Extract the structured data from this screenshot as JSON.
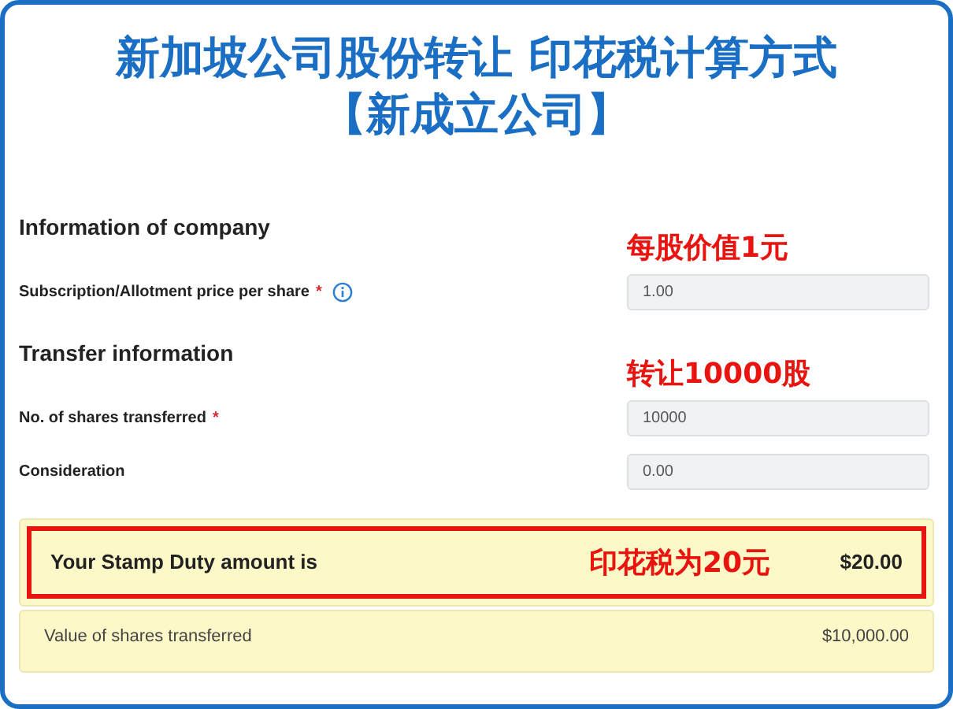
{
  "title_lines": [
    "新加坡公司股份转让 印花税计算方式",
    "【新成立公司】"
  ],
  "sections": [
    {
      "heading": "Information of company",
      "note": "每股价值1元",
      "fields": [
        {
          "label": "Subscription/Allotment price per share",
          "required_mark": "*",
          "info": true,
          "value": "1.00"
        }
      ]
    },
    {
      "heading": "Transfer information",
      "note": "转让10000股",
      "fields": [
        {
          "label": "No. of shares transferred",
          "required_mark": "*",
          "info": false,
          "value": "10000"
        },
        {
          "label": "Consideration",
          "info": false,
          "value": "0.00"
        }
      ]
    }
  ],
  "result": {
    "label": "Your Stamp Duty amount is",
    "note": "印花税为20元",
    "amount": "$20.00",
    "highlighted": true
  },
  "detail": {
    "label": "Value of shares transferred",
    "amount": "$10,000.00"
  }
}
